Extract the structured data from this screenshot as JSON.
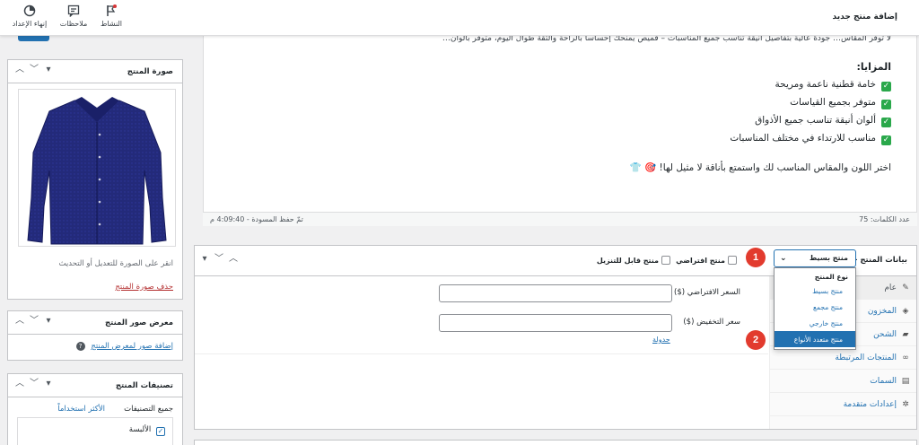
{
  "topbar": {
    "page_title": "إضافة منتج جديد",
    "buttons": [
      {
        "label": "النشاط",
        "icon": "flag-icon"
      },
      {
        "label": "ملاحظات",
        "icon": "notes-icon"
      },
      {
        "label": "إنهاء الإعداد",
        "icon": "progress-icon"
      }
    ]
  },
  "editor": {
    "top_line": "لا توفر المقاس… جودة عالية بتفاصيل أنيقة تناسب جميع المناسبات – قميص يمنحك إحساساً بالراحة والثقة طوال اليوم، متوفر بألوان…",
    "features_heading": "المزايا:",
    "features": [
      "خامة قطنية ناعمة ومريحة",
      "متوفر بجميع القياسات",
      "ألوان أنيقة تناسب جميع الأذواق",
      "مناسب للارتداء في مختلف المناسبات"
    ],
    "closing_line": "اختر اللون والمقاس المناسب لك واستمتع بأناقة لا مثيل لها! 🎯 👕",
    "word_count": "عدد الكلمات: 75",
    "draft_saved": "تمّ حفظ المسودة - 4:09:40 م"
  },
  "product_image": {
    "title": "صورة المنتج",
    "hint": "انقر على الصورة للتعديل أو التحديث",
    "remove_link": "حذف صورة المنتج"
  },
  "gallery": {
    "title": "معرض صور المنتج",
    "add_link": "إضافة صور لمعرض المنتج"
  },
  "categories": {
    "title": "تصنيفات المنتج",
    "tab_all": "جميع التصنيفات",
    "tab_popular": "الأكثر استخداماً",
    "items": [
      {
        "label": "الألبسة",
        "checked": true
      }
    ]
  },
  "product_data": {
    "title": "بيانات المنتج —",
    "type_selected": "منتج بسيط",
    "virtual_label": "منتج افتراضي",
    "downloadable_label": "منتج قابل للتنزيل",
    "dropdown": {
      "group_label": "نوع المنتج",
      "options": [
        {
          "label": "منتج بسيط",
          "selected": false
        },
        {
          "label": "منتج مجمع",
          "selected": false
        },
        {
          "label": "منتج خارجي",
          "selected": false
        },
        {
          "label": "منتج متعدد الأنواع",
          "selected": true
        }
      ]
    },
    "tabs": [
      {
        "label": "عام",
        "icon": "wrench-icon"
      },
      {
        "label": "المخزون",
        "icon": "tag-icon"
      },
      {
        "label": "الشحن",
        "icon": "truck-icon"
      },
      {
        "label": "المنتجات المرتبطة",
        "icon": "link-icon"
      },
      {
        "label": "السمات",
        "icon": "list-icon"
      },
      {
        "label": "إعدادات متقدمة",
        "icon": "gear-icon"
      }
    ],
    "regular_price_label": "السعر الافتراضي ($)",
    "sale_price_label": "سعر التخفيض ($)",
    "schedule_link": "جدولة"
  },
  "annotations": [
    "1",
    "2"
  ],
  "colors": {
    "accent": "#2271b1",
    "badge": "#e23b2e",
    "check": "#2aa84b"
  }
}
